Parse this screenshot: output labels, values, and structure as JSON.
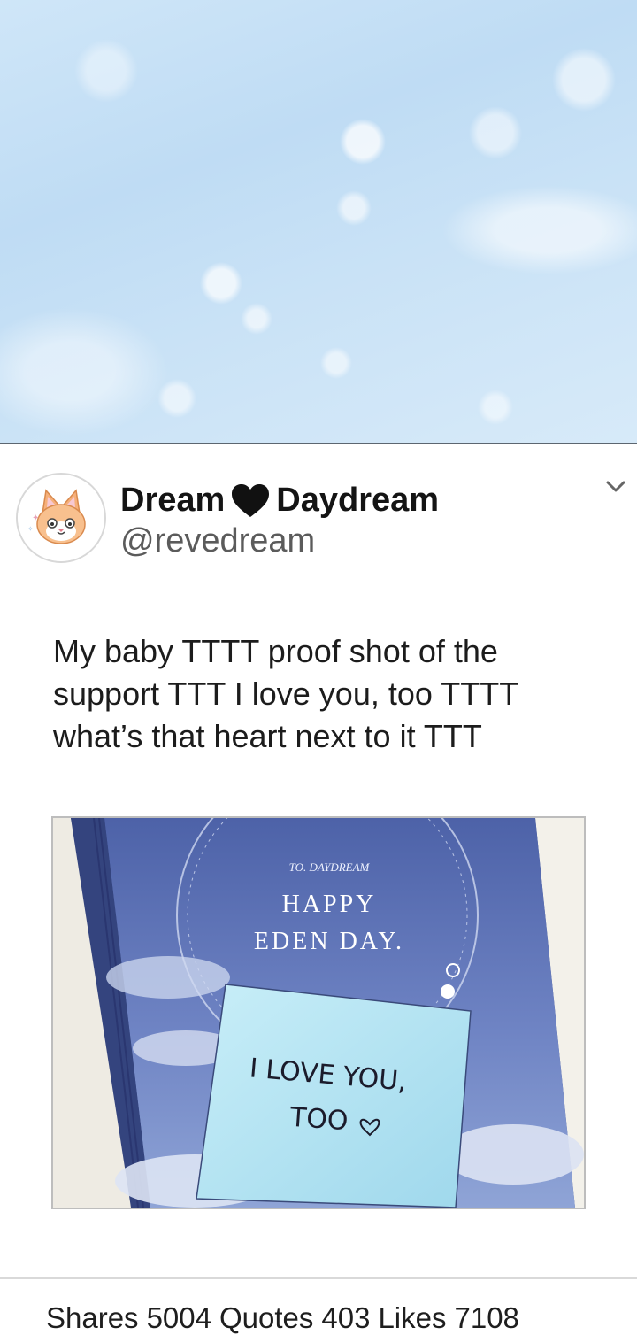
{
  "header": {
    "name_part1": "Dream",
    "name_part2": "Daydream",
    "handle": "@revedream"
  },
  "tweet": {
    "text": "My baby TTTT proof shot of the support TTT I love you, too TTTT what’s that heart next to it TTT"
  },
  "image": {
    "card_to": "TO. DAYDREAM",
    "card_line1": "HAPPY",
    "card_line2": "EDEN DAY.",
    "note_line1": "I LOVE YOU,",
    "note_line2": "TOO"
  },
  "stats": {
    "shares_label": "Shares",
    "shares_value": "5004",
    "quotes_label": "Quotes",
    "quotes_value": "403",
    "likes_label": "Likes",
    "likes_value": "7108"
  },
  "colors": {
    "sky_blue": "#c9e2f6",
    "card_blue": "#5f74b8",
    "sticky_note": "#b9e6f3",
    "text": "#1c1c1c",
    "handle_gray": "#5b5b5b"
  },
  "icons": {
    "avatar": "cat-face-avatar",
    "heart": "black-heart-icon",
    "chevron": "chevron-down-icon"
  }
}
